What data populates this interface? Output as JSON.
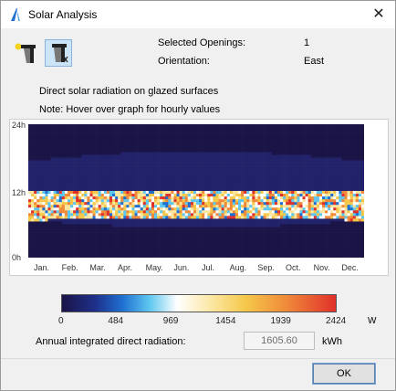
{
  "window": {
    "title": "Solar Analysis",
    "close_label": "✕"
  },
  "toolbar": {
    "buttons": [
      {
        "icon": "sun-column-icon",
        "selected": false
      },
      {
        "icon": "opening-shadow-icon",
        "selected": true
      }
    ]
  },
  "info": {
    "selected_openings_label": "Selected Openings:",
    "selected_openings_value": "1",
    "orientation_label": "Orientation:",
    "orientation_value": "East"
  },
  "description": {
    "line1": "Direct solar radiation on glazed surfaces",
    "line2": "Note: Hover over graph for hourly values"
  },
  "chart_data": {
    "type": "heatmap",
    "title": "Direct solar radiation on glazed surfaces",
    "y_ticks": [
      "24h",
      "12h",
      "0h"
    ],
    "y_range_hours": [
      0,
      24
    ],
    "x_categories": [
      "Jan.",
      "Feb.",
      "Mar.",
      "Apr.",
      "May.",
      "Jun.",
      "Jul.",
      "Aug.",
      "Sep.",
      "Oct.",
      "Nov.",
      "Dec."
    ],
    "value_unit": "W",
    "color_scale_ticks": [
      "0",
      "484",
      "969",
      "1454",
      "1939",
      "2424"
    ],
    "value_range": [
      0,
      2424
    ],
    "colors": {
      "night": "#1a1447",
      "day_no_direct": "#22226a",
      "low": "#1f6fd0",
      "mid": "#ffffff",
      "high": "#f5c84a",
      "max": "#e0302a"
    }
  },
  "annual": {
    "label": "Annual integrated direct radiation:",
    "value": "1605.60",
    "unit": "kWh"
  },
  "ok_label": "OK"
}
